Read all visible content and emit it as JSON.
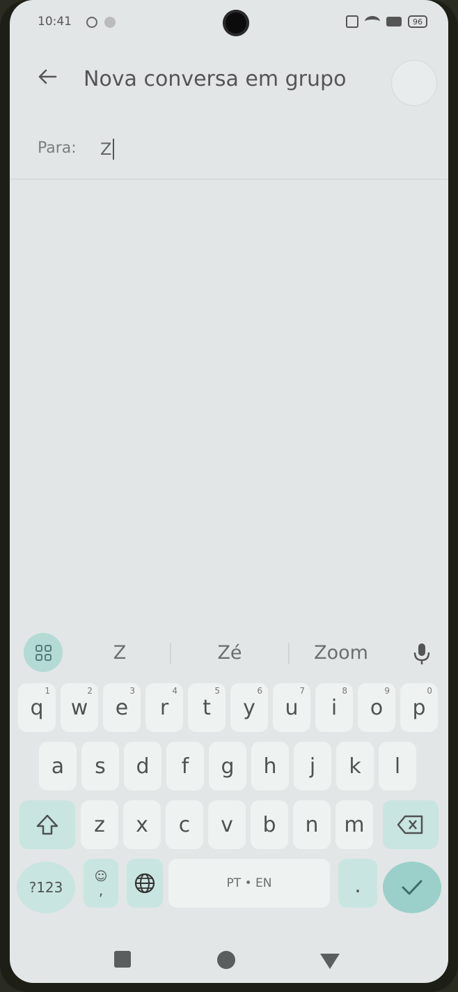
{
  "status_bar": {
    "time": "10:41",
    "battery": "96"
  },
  "header": {
    "title": "Nova conversa em grupo"
  },
  "recipients": {
    "label": "Para:",
    "input_value": "Z"
  },
  "suggestions": [
    "Z",
    "Zé",
    "Zoom"
  ],
  "keyboard": {
    "row1": [
      {
        "k": "q",
        "n": "1"
      },
      {
        "k": "w",
        "n": "2"
      },
      {
        "k": "e",
        "n": "3"
      },
      {
        "k": "r",
        "n": "4"
      },
      {
        "k": "t",
        "n": "5"
      },
      {
        "k": "y",
        "n": "6"
      },
      {
        "k": "u",
        "n": "7"
      },
      {
        "k": "i",
        "n": "8"
      },
      {
        "k": "o",
        "n": "9"
      },
      {
        "k": "p",
        "n": "0"
      }
    ],
    "row2": [
      "a",
      "s",
      "d",
      "f",
      "g",
      "h",
      "j",
      "k",
      "l"
    ],
    "row3": [
      "z",
      "x",
      "c",
      "v",
      "b",
      "n",
      "m"
    ],
    "symbols_label": "?123",
    "emoji_sub": ",",
    "space_label": "PT • EN",
    "period": "."
  },
  "colors": {
    "accent": "#9ad0c9",
    "screen_bg": "#e2e6e6",
    "key_bg": "#eef2f1"
  }
}
